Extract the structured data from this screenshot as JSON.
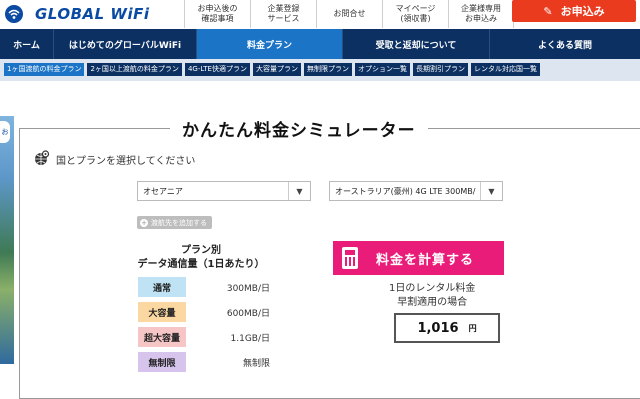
{
  "header": {
    "logo_text": "GLOBAL WiFi",
    "top_links": [
      {
        "label": "お申込後の\n確認事項"
      },
      {
        "label": "企業登録\nサービス"
      },
      {
        "label": "お問合せ"
      },
      {
        "label": "マイページ\n(領収書)"
      },
      {
        "label": "企業様専用\nお申込み"
      }
    ],
    "apply_label": "お申込み",
    "apply_color": "#ea3b1f"
  },
  "nav": {
    "items": [
      {
        "label": "ホーム"
      },
      {
        "label": "はじめてのグローバルWiFi"
      },
      {
        "label": "料金プラン"
      },
      {
        "label": "受取と返却について"
      },
      {
        "label": "よくある質問"
      }
    ],
    "active_color": "#1c74c6",
    "bg_color": "#0c3062"
  },
  "subnav": {
    "items": [
      {
        "label": "1ヶ国渡航の料金プラン"
      },
      {
        "label": "2ヶ国以上渡航の料金プラン"
      },
      {
        "label": "4G-LTE快適プラン"
      },
      {
        "label": "大容量プラン"
      },
      {
        "label": "無制限プラン"
      },
      {
        "label": "オプション一覧"
      },
      {
        "label": "長期割引プラン"
      },
      {
        "label": "レンタル対応国一覧"
      }
    ]
  },
  "simulator": {
    "title": "かんたん料金シミュレーター",
    "select_label": "国とプランを選択してください",
    "region_value": "オセアニア",
    "plan_value": "オーストラリア(豪州) 4G LTE 300MB/",
    "add_destination_label": "渡航先を追加する",
    "plan_heading": "プラン別\nデータ通信量（1日あたり）",
    "plans": [
      {
        "name": "通常",
        "value": "300MB/日",
        "color": "#bfe3f4"
      },
      {
        "name": "大容量",
        "value": "600MB/日",
        "color": "#fbd7a1"
      },
      {
        "name": "超大容量",
        "value": "1.1GB/日",
        "color": "#f6c6c6"
      },
      {
        "name": "無制限",
        "value": "無制限",
        "color": "#d7c4ec"
      }
    ],
    "calc_label": "料金を計算する",
    "calc_color": "#ea1c79",
    "price_note": "1日のレンタル料金\n早割適用の場合",
    "price_amount": "1,016",
    "price_unit": "円"
  },
  "side_banner": {
    "text": "お"
  }
}
